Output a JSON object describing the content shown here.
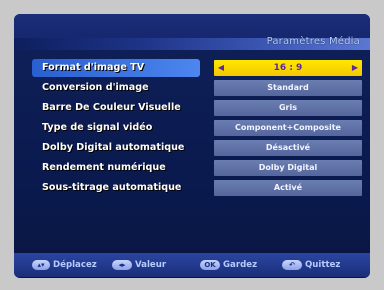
{
  "header": {
    "title": "Paramètres Média"
  },
  "menu": {
    "items": [
      {
        "label": "Format d'image TV",
        "value": "16 : 9",
        "selected": true
      },
      {
        "label": "Conversion d'image",
        "value": "Standard",
        "selected": false
      },
      {
        "label": "Barre De Couleur Visuelle",
        "value": "Gris",
        "selected": false
      },
      {
        "label": "Type de signal vidéo",
        "value": "Component+Composite",
        "selected": false
      },
      {
        "label": "Dolby Digital automatique",
        "value": "Désactivé",
        "selected": false
      },
      {
        "label": "Rendement numérique",
        "value": "Dolby Digital",
        "selected": false
      },
      {
        "label": "Sous-titrage automatique",
        "value": "Activé",
        "selected": false
      }
    ]
  },
  "footer": {
    "hints": [
      {
        "key": "up-down",
        "label": "Déplacez"
      },
      {
        "key": "left-right",
        "label": "Valeur"
      },
      {
        "key": "OK",
        "label": "Gardez"
      },
      {
        "key": "exit",
        "label": "Quittez"
      }
    ]
  },
  "icons": {
    "left_arrow": "left-arrow-icon",
    "right_arrow": "right-arrow-icon"
  },
  "colors": {
    "selected_value_bg": "#f5c700",
    "selected_label_bg": "#2f68d8",
    "value_bg": "#5f73aa",
    "screen_bg": "#0c1b52"
  }
}
